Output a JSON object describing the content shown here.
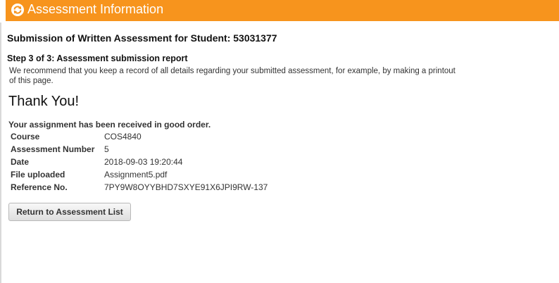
{
  "header": {
    "title": "Assessment Information",
    "icon": "refresh-circle-icon",
    "color": "#f7941d"
  },
  "page": {
    "title": "Submission of Written Assessment for Student: 53031377",
    "step_title": "Step 3 of 3: Assessment submission report",
    "recommendation": "We recommend that you keep a record of all details regarding your submitted assessment, for example, by making a printout of this page.",
    "thank_you": "Thank You!",
    "received_message": "Your assignment has been received in good order."
  },
  "details": [
    {
      "label": "Course",
      "value": "COS4840"
    },
    {
      "label": "Assessment Number",
      "value": "5"
    },
    {
      "label": "Date",
      "value": "2018-09-03 19:20:44"
    },
    {
      "label": "File uploaded",
      "value": "Assignment5.pdf"
    },
    {
      "label": "Reference No.",
      "value": "7PY9W8OYYBHD7SXYE91X6JPI9RW-137"
    }
  ],
  "actions": {
    "return_label": "Return to Assessment List"
  }
}
